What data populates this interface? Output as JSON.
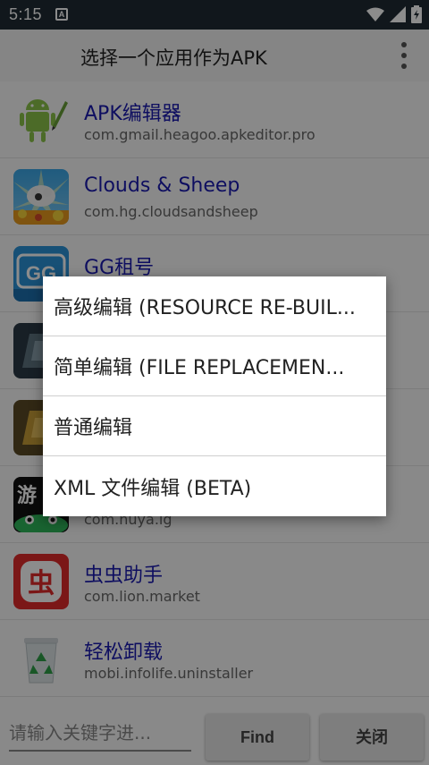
{
  "status_bar": {
    "time": "5:15",
    "notification_glyph": "A"
  },
  "app_bar": {
    "title": "选择一个应用作为APK",
    "menu_icon": "more-vert-icon"
  },
  "apps": [
    {
      "name": "APK编辑器",
      "package": "com.gmail.heagoo.apkeditor.pro"
    },
    {
      "name": "Clouds & Sheep",
      "package": "com.hg.cloudsandsheep"
    },
    {
      "name": "GG租号",
      "package": "",
      "icon_text": "GG"
    },
    {
      "name": "",
      "package": ""
    },
    {
      "name": "",
      "package": ""
    },
    {
      "name": "",
      "package": "com.huya.lg",
      "icon_text": "游"
    },
    {
      "name": "虫虫助手",
      "package": "com.lion.market",
      "icon_text": "虫"
    },
    {
      "name": "轻松卸载",
      "package": "mobi.infolife.uninstaller"
    }
  ],
  "dialog": {
    "options": [
      "高级编辑 (RESOURCE RE-BUIL...",
      "简单编辑 (FILE REPLACEMEN...",
      "普通编辑",
      "XML 文件编辑 (BETA)"
    ]
  },
  "bottom_bar": {
    "search_placeholder": "请输入关键字进...",
    "find_label": "Find",
    "close_label": "关闭"
  },
  "colors": {
    "status_bar": "#1f2a33",
    "app_name": "#1a1ab0",
    "scrim": "rgba(0,0,0,0.45)"
  }
}
